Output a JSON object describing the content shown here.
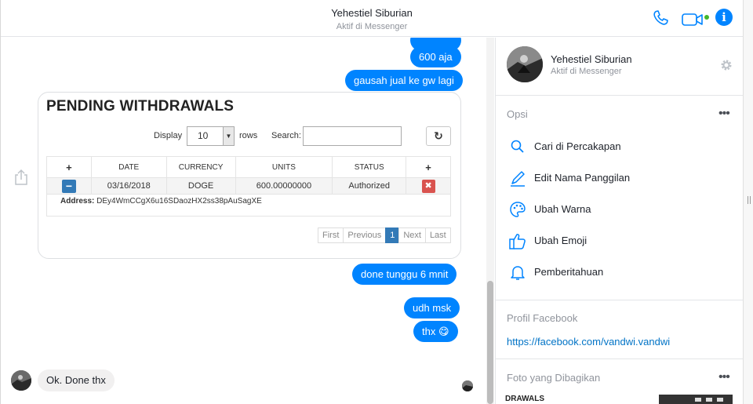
{
  "header": {
    "contact_name": "Yehestiel Siburian",
    "contact_status": "Aktif di Messenger"
  },
  "messages": [
    {
      "from": "me",
      "text": "600 aja"
    },
    {
      "from": "me",
      "text": "gausah jual ke gw lagi"
    },
    {
      "from": "me",
      "text": "done tunggu 6 mnit"
    },
    {
      "from": "me",
      "text": "udh msk"
    },
    {
      "from": "me",
      "text": "thx",
      "emoji": "😋"
    },
    {
      "from": "them",
      "text": "Ok. Done thx"
    }
  ],
  "withdrawals_card": {
    "title": "PENDING WITHDRAWALS",
    "display_label": "Display",
    "rows_value": "10",
    "rows_label": "rows",
    "search_label": "Search:",
    "columns": [
      "+",
      "DATE",
      "CURRENCY",
      "UNITS",
      "STATUS",
      "+"
    ],
    "rows": [
      {
        "date": "03/16/2018",
        "currency": "DOGE",
        "units": "600.00000000",
        "status": "Authorized"
      }
    ],
    "address_label": "Address:",
    "address_value": "DEy4WmCCgX6u16SDaozHX2ss38pAuSagXE",
    "pager": [
      "First",
      "Previous",
      "1",
      "Next",
      "Last"
    ]
  },
  "side": {
    "name": "Yehestiel Siburian",
    "status": "Aktif di Messenger",
    "options_title": "Opsi",
    "options": [
      {
        "label": "Cari di Percakapan",
        "icon": "search-icon"
      },
      {
        "label": "Edit Nama Panggilan",
        "icon": "pencil-icon"
      },
      {
        "label": "Ubah Warna",
        "icon": "palette-icon"
      },
      {
        "label": "Ubah Emoji",
        "icon": "thumbs-up-icon"
      },
      {
        "label": "Pemberitahuan",
        "icon": "bell-icon"
      }
    ],
    "profile_title": "Profil Facebook",
    "profile_link": "https://facebook.com/vandwi.vandwi",
    "shared_title": "Foto yang Dibagikan",
    "shared_thumb_text": "DRAWALS"
  },
  "colors": {
    "accent": "#0084ff",
    "online": "#42b72a",
    "incoming": "#f1f0f0"
  }
}
